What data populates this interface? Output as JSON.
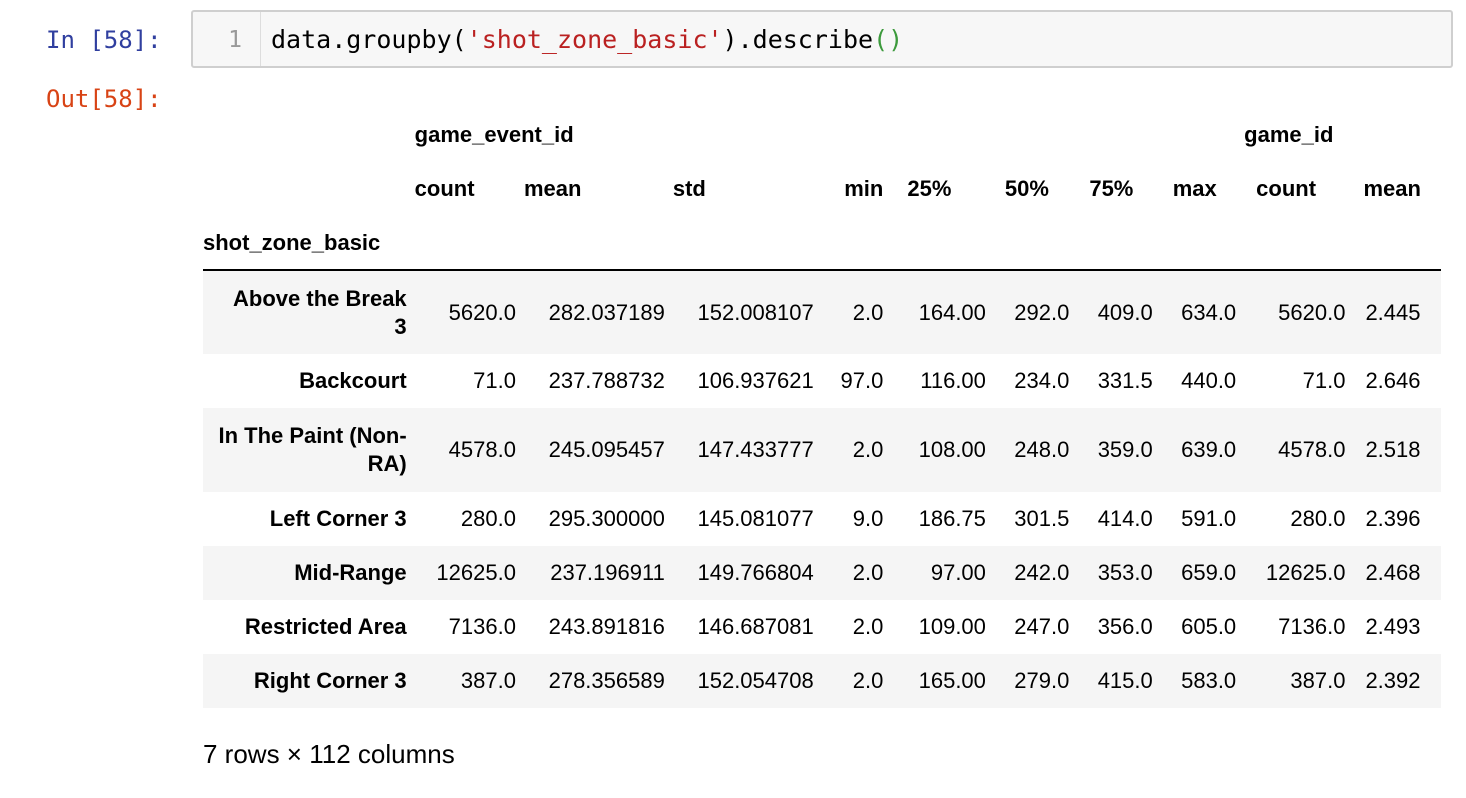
{
  "cell": {
    "in_prompt": "In [58]:",
    "out_prompt": "Out[58]:",
    "line_number": "1",
    "code": {
      "prefix": "data.groupby(",
      "string": "'shot_zone_basic'",
      "middle": ").describe",
      "parens": "()"
    }
  },
  "table": {
    "group_headers": [
      "game_event_id",
      "game_id"
    ],
    "columns": [
      "count",
      "mean",
      "std",
      "min",
      "25%",
      "50%",
      "75%",
      "max",
      "count",
      "mean"
    ],
    "index_name": "shot_zone_basic",
    "rows": [
      {
        "label": "Above the Break 3",
        "values": [
          "5620.0",
          "282.037189",
          "152.008107",
          "2.0",
          "164.00",
          "292.0",
          "409.0",
          "634.0",
          "5620.0",
          "2.445"
        ]
      },
      {
        "label": "Backcourt",
        "values": [
          "71.0",
          "237.788732",
          "106.937621",
          "97.0",
          "116.00",
          "234.0",
          "331.5",
          "440.0",
          "71.0",
          "2.646"
        ]
      },
      {
        "label": "In The Paint (Non-RA)",
        "values": [
          "4578.0",
          "245.095457",
          "147.433777",
          "2.0",
          "108.00",
          "248.0",
          "359.0",
          "639.0",
          "4578.0",
          "2.518"
        ]
      },
      {
        "label": "Left Corner 3",
        "values": [
          "280.0",
          "295.300000",
          "145.081077",
          "9.0",
          "186.75",
          "301.5",
          "414.0",
          "591.0",
          "280.0",
          "2.396"
        ]
      },
      {
        "label": "Mid-Range",
        "values": [
          "12625.0",
          "237.196911",
          "149.766804",
          "2.0",
          "97.00",
          "242.0",
          "353.0",
          "659.0",
          "12625.0",
          "2.468"
        ]
      },
      {
        "label": "Restricted Area",
        "values": [
          "7136.0",
          "243.891816",
          "146.687081",
          "2.0",
          "109.00",
          "247.0",
          "356.0",
          "605.0",
          "7136.0",
          "2.493"
        ]
      },
      {
        "label": "Right Corner 3",
        "values": [
          "387.0",
          "278.356589",
          "152.054708",
          "2.0",
          "165.00",
          "279.0",
          "415.0",
          "583.0",
          "387.0",
          "2.392"
        ]
      }
    ],
    "shape_note": "7 rows × 112 columns"
  }
}
